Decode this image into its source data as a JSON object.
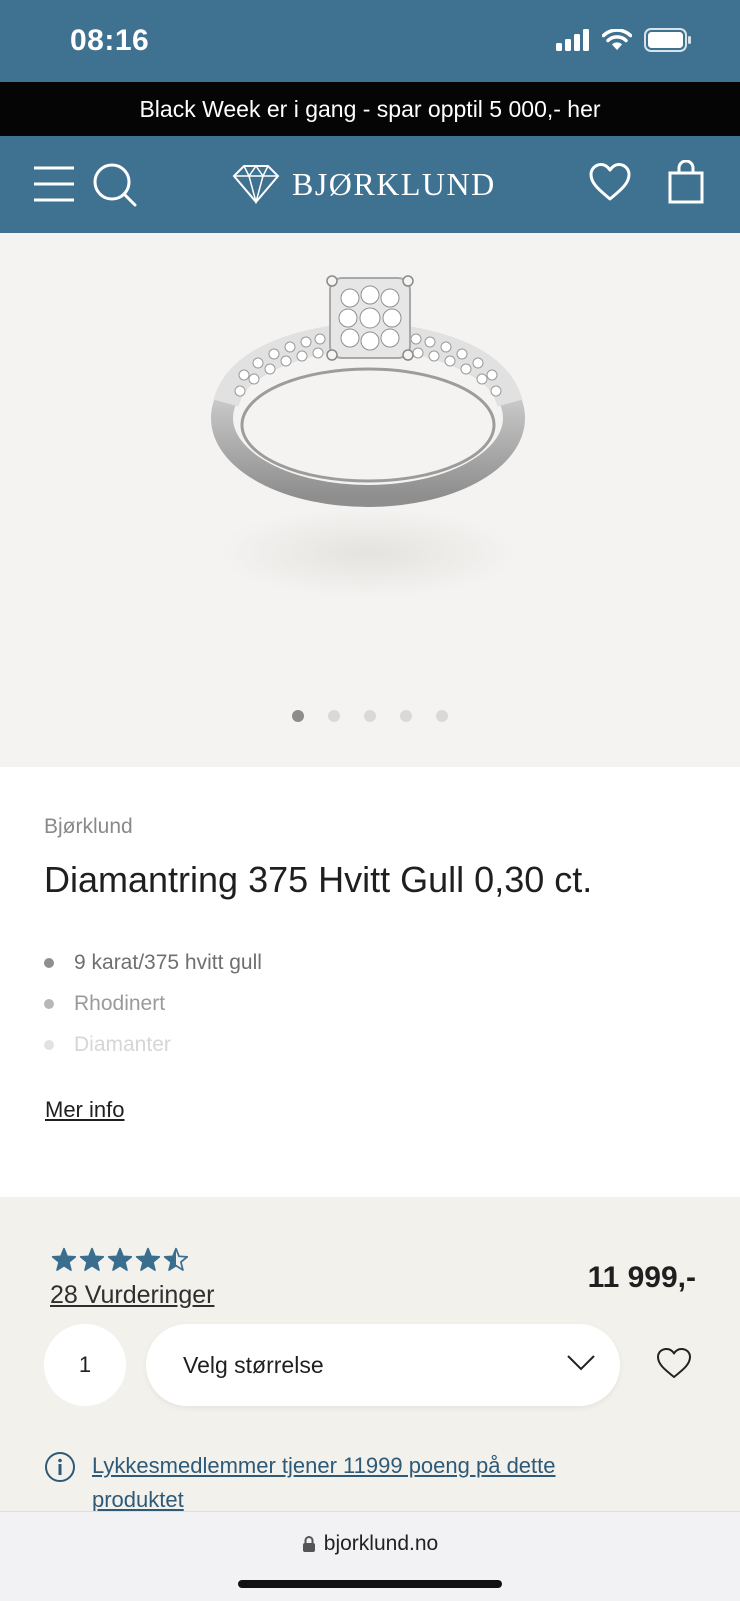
{
  "status_bar": {
    "time": "08:16"
  },
  "promo": {
    "text": "Black Week er i gang - spar opptil 5 000,- her"
  },
  "header": {
    "logo_text": "BJØRKLUND"
  },
  "gallery": {
    "image_count": 5,
    "active_index": 0
  },
  "product": {
    "brand": "Bjørklund",
    "title": "Diamantring 375 Hvitt Gull 0,30 ct.",
    "features": [
      "9 karat/375 hvitt gull",
      "Rhodinert",
      "Diamanter"
    ],
    "more_info_label": "Mer info"
  },
  "purchase": {
    "rating": 4.5,
    "rating_max": 5,
    "reviews_label": "28 Vurderinger",
    "price": "11 999,-",
    "quantity": "1",
    "size_label": "Velg størrelse",
    "loyalty_text": "Lykkesmedlemmer tjener 11999 poeng på dette produktet"
  },
  "browser": {
    "url": "bjorklund.no"
  },
  "colors": {
    "brand_blue": "#3f7190",
    "star_blue": "#3a6e8f",
    "panel_bg": "#f3f1ec"
  },
  "icons": [
    "signal-icon",
    "wifi-icon",
    "battery-icon",
    "menu-icon",
    "search-icon",
    "diamond-logo-icon",
    "heart-icon",
    "bag-icon",
    "chevron-down-icon",
    "info-icon",
    "lock-icon"
  ]
}
